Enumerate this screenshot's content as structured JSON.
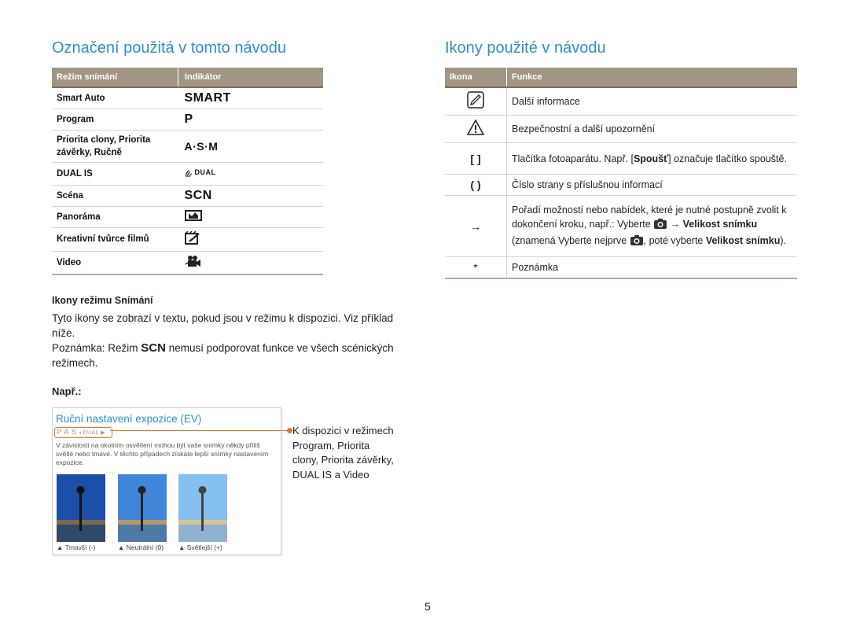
{
  "left": {
    "heading": "Označení použitá v tomto návodu",
    "table": {
      "headers": [
        "Režim snímání",
        "Indikátor"
      ],
      "rows": [
        {
          "mode": "Smart Auto",
          "indicator": "SMART"
        },
        {
          "mode": "Program",
          "indicator": "P"
        },
        {
          "mode": "Priorita clony, Priorita závěrky, Ručně",
          "indicator": "A·S·M"
        },
        {
          "mode": "DUAL IS",
          "indicator": "DUAL",
          "icon": "dual-is-icon"
        },
        {
          "mode": "Scéna",
          "indicator": "SCN"
        },
        {
          "mode": "Panoráma",
          "indicator": "",
          "icon": "panorama-icon"
        },
        {
          "mode": "Kreativní tvůrce filmů",
          "indicator": "",
          "icon": "movie-maker-icon"
        },
        {
          "mode": "Video",
          "indicator": "",
          "icon": "video-camera-icon"
        }
      ]
    },
    "subheading": "Ikony režimu Snímání",
    "para1": "Tyto ikony se zobrazí v textu, pokud jsou v režimu k dispozici. Viz příklad níže.",
    "para2_pre": "Poznámka: Režim ",
    "para2_icon": "SCN",
    "para2_post": " nemusí podporovat funkce ve všech scénických režimech.",
    "example_label": "Např.:",
    "example_box": {
      "title": "Ruční nastavení expozice (EV)",
      "modes": "P A S",
      "text": "V závislosti na okolním osvětlení mohou být vaše snímky někdy příliš světlé nebo tmavé. V těchto případech získáte lepší snímky nastavením expozice.",
      "captions": [
        "Tmavší (-)",
        "Neutrální (0)",
        "Světlejší (+)"
      ]
    },
    "example_note": "K dispozici v režimech Program, Priorita clony, Priorita závěrky, DUAL IS a Video"
  },
  "right": {
    "heading": "Ikony použité v návodu",
    "table": {
      "headers": [
        "Ikona",
        "Funkce"
      ],
      "row1": {
        "icon": "info-icon",
        "text": "Další informace"
      },
      "row2": {
        "icon": "warning-icon",
        "text": "Bezpečnostní a další upozornění"
      },
      "row3": {
        "icon": "[ ]",
        "text_pre": "Tlačítka fotoaparátu. Např. [",
        "bold": "Spoušť",
        "text_post": "] označuje tlačítko spouště."
      },
      "row4": {
        "icon": "( )",
        "text": "Číslo strany s příslušnou informací"
      },
      "row5": {
        "icon": "→",
        "part1": "Pořadí možností nebo nabídek, které je nutné postupně zvolit k dokončení kroku, např.: Vyberte ",
        "part2": " → ",
        "bold1": "Velikost snímku",
        "part3": " (znamená Vyberte nejprve ",
        "part4": ", poté vyberte ",
        "bold2": "Velikost snímku",
        "part5": ")."
      },
      "row6": {
        "icon": "*",
        "text": "Poznámka"
      }
    }
  },
  "page_number": "5",
  "colors": {
    "accent_blue": "#2b8fd0",
    "header_bg": "#a39584",
    "highlight_orange": "#e07a2a"
  }
}
